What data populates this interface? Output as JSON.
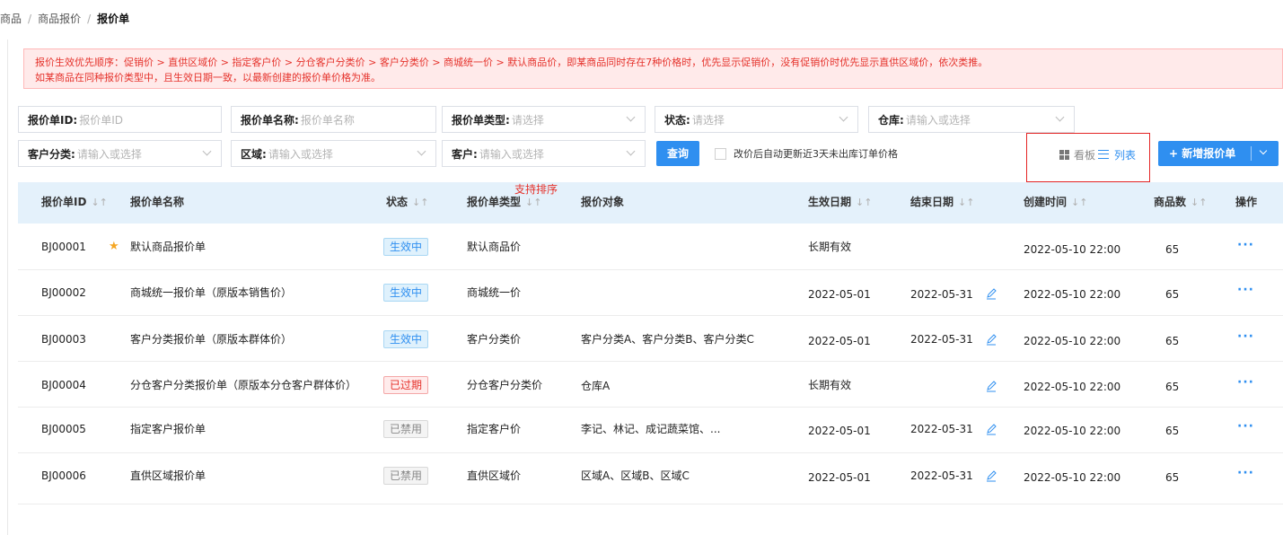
{
  "breadcrumb": {
    "items": [
      "商品",
      "商品报价"
    ],
    "current": "报价单",
    "separator": "/"
  },
  "notice": {
    "line1": "报价生效优先顺序：促销价 > 直供区域价 > 指定客户价 > 分仓客户分类价 > 客户分类价 > 商城统一价 > 默认商品价，即某商品同时存在7种价格时，优先显示促销价，没有促销价时优先显示直供区域价，依次类推。",
    "line2": "如某商品在同种报价类型中，且生效日期一致，以最新创建的报价单价格为准。"
  },
  "filters": {
    "quote_id": {
      "label": "报价单ID:",
      "placeholder": "报价单ID"
    },
    "quote_name": {
      "label": "报价单名称:",
      "placeholder": "报价单名称"
    },
    "quote_type": {
      "label": "报价单类型:",
      "placeholder": "请选择"
    },
    "status": {
      "label": "状态:",
      "placeholder": "请选择"
    },
    "warehouse": {
      "label": "仓库:",
      "placeholder": "请输入或选择"
    },
    "customer_category": {
      "label": "客户分类:",
      "placeholder": "请输入或选择"
    },
    "region": {
      "label": "区域:",
      "placeholder": "请输入或选择"
    },
    "customer": {
      "label": "客户:",
      "placeholder": "请输入或选择"
    }
  },
  "query_button": "查询",
  "auto_update_checkbox": {
    "label": "改价后自动更新近3天未出库订单价格",
    "checked": false
  },
  "view_toggle": {
    "board": "看板",
    "list": "列表",
    "active": "list"
  },
  "new_button": "+ 新增报价单",
  "sort_note": "支持排序",
  "colors": {
    "primary": "#2f8ff0",
    "danger": "#e5322b",
    "star": "#f5a623",
    "header_bg": "#e4f1fb",
    "notice_bg": "#ffeaea"
  },
  "table": {
    "headers": [
      "报价单ID",
      "报价单名称",
      "状态",
      "报价单类型",
      "报价对象",
      "生效日期",
      "结束日期",
      "创建时间",
      "商品数",
      "操作"
    ],
    "rows": [
      {
        "id": "BJ00001",
        "starred": true,
        "name": "默认商品报价单",
        "status": "生效中",
        "status_type": "active",
        "type": "默认商品价",
        "target": "",
        "start": "长期有效",
        "end": "",
        "editable_end": false,
        "created": "2022-05-10 22:00",
        "count": "65",
        "action": "···"
      },
      {
        "id": "BJ00002",
        "starred": false,
        "name": "商城统一报价单（原版本销售价）",
        "status": "生效中",
        "status_type": "active",
        "type": "商城统一价",
        "target": "",
        "start": "2022-05-01",
        "end": "2022-05-31",
        "editable_end": true,
        "created": "2022-05-10 22:00",
        "count": "65",
        "action": "···"
      },
      {
        "id": "BJ00003",
        "starred": false,
        "name": "客户分类报价单（原版本群体价）",
        "status": "生效中",
        "status_type": "active",
        "type": "客户分类价",
        "target": "客户分类A、客户分类B、客户分类C",
        "start": "2022-05-01",
        "end": "2022-05-31",
        "editable_end": true,
        "created": "2022-05-10 22:00",
        "count": "65",
        "action": "···"
      },
      {
        "id": "BJ00004",
        "starred": false,
        "name": "分仓客户分类报价单（原版本分仓客户群体价）",
        "status": "已过期",
        "status_type": "expired",
        "type": "分仓客户分类价",
        "target": "仓库A",
        "start": "长期有效",
        "end": "",
        "editable_end": true,
        "created": "2022-05-10 22:00",
        "count": "65",
        "action": "···"
      },
      {
        "id": "BJ00005",
        "starred": false,
        "name": "指定客户报价单",
        "status": "已禁用",
        "status_type": "disabled",
        "type": "指定客户价",
        "target": "李记、林记、成记蔬菜馆、...",
        "start": "2022-05-01",
        "end": "2022-05-31",
        "editable_end": true,
        "created": "2022-05-10 22:00",
        "count": "65",
        "action": "···"
      },
      {
        "id": "BJ00006",
        "starred": false,
        "name": "直供区域报价单",
        "status": "已禁用",
        "status_type": "disabled",
        "type": "直供区域价",
        "target": "区域A、区域B、区域C",
        "start": "2022-05-01",
        "end": "2022-05-31",
        "editable_end": true,
        "created": "2022-05-10 22:00",
        "count": "65",
        "action": "···"
      }
    ]
  }
}
